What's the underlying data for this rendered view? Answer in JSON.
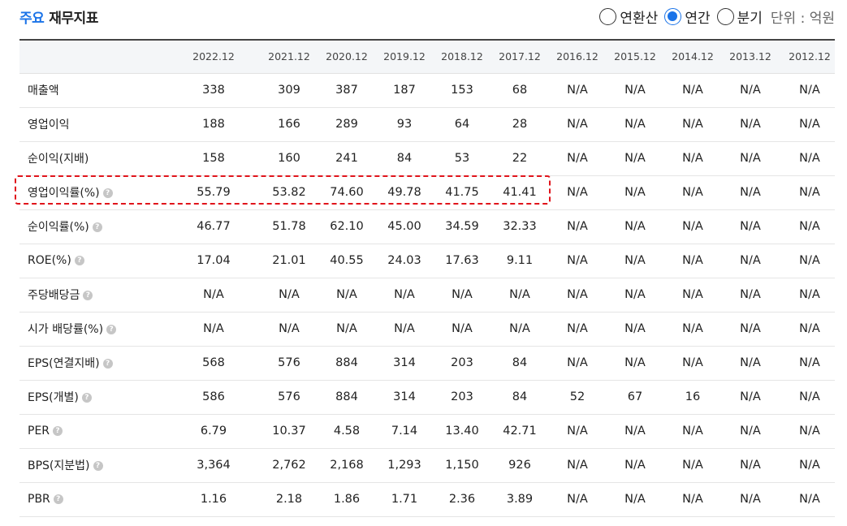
{
  "header": {
    "title_accent": "주요",
    "title_rest": "재무지표",
    "radios": [
      {
        "label": "연환산",
        "checked": false
      },
      {
        "label": "연간",
        "checked": true
      },
      {
        "label": "분기",
        "checked": false
      }
    ],
    "unit": "단위 : 억원"
  },
  "table": {
    "columns": [
      "2022.12",
      "2021.12",
      "2020.12",
      "2019.12",
      "2018.12",
      "2017.12",
      "2016.12",
      "2015.12",
      "2014.12",
      "2013.12",
      "2012.12"
    ],
    "rows": [
      {
        "label": "매출액",
        "help": false,
        "values": [
          "338",
          "309",
          "387",
          "187",
          "153",
          "68",
          "N/A",
          "N/A",
          "N/A",
          "N/A",
          "N/A"
        ]
      },
      {
        "label": "영업이익",
        "help": false,
        "values": [
          "188",
          "166",
          "289",
          "93",
          "64",
          "28",
          "N/A",
          "N/A",
          "N/A",
          "N/A",
          "N/A"
        ]
      },
      {
        "label": "순이익(지배)",
        "help": false,
        "values": [
          "158",
          "160",
          "241",
          "84",
          "53",
          "22",
          "N/A",
          "N/A",
          "N/A",
          "N/A",
          "N/A"
        ]
      },
      {
        "label": "영업이익률(%)",
        "help": true,
        "values": [
          "55.79",
          "53.82",
          "74.60",
          "49.78",
          "41.75",
          "41.41",
          "N/A",
          "N/A",
          "N/A",
          "N/A",
          "N/A"
        ]
      },
      {
        "label": "순이익률(%)",
        "help": true,
        "values": [
          "46.77",
          "51.78",
          "62.10",
          "45.00",
          "34.59",
          "32.33",
          "N/A",
          "N/A",
          "N/A",
          "N/A",
          "N/A"
        ]
      },
      {
        "label": "ROE(%)",
        "help": true,
        "values": [
          "17.04",
          "21.01",
          "40.55",
          "24.03",
          "17.63",
          "9.11",
          "N/A",
          "N/A",
          "N/A",
          "N/A",
          "N/A"
        ]
      },
      {
        "label": "주당배당금",
        "help": true,
        "values": [
          "N/A",
          "N/A",
          "N/A",
          "N/A",
          "N/A",
          "N/A",
          "N/A",
          "N/A",
          "N/A",
          "N/A",
          "N/A"
        ]
      },
      {
        "label": "시가 배당률(%)",
        "help": true,
        "values": [
          "N/A",
          "N/A",
          "N/A",
          "N/A",
          "N/A",
          "N/A",
          "N/A",
          "N/A",
          "N/A",
          "N/A",
          "N/A"
        ]
      },
      {
        "label": "EPS(연결지배)",
        "help": true,
        "values": [
          "568",
          "576",
          "884",
          "314",
          "203",
          "84",
          "N/A",
          "N/A",
          "N/A",
          "N/A",
          "N/A"
        ]
      },
      {
        "label": "EPS(개별)",
        "help": true,
        "values": [
          "586",
          "576",
          "884",
          "314",
          "203",
          "84",
          "52",
          "67",
          "16",
          "N/A",
          "N/A"
        ]
      },
      {
        "label": "PER",
        "help": true,
        "values": [
          "6.79",
          "10.37",
          "4.58",
          "7.14",
          "13.40",
          "42.71",
          "N/A",
          "N/A",
          "N/A",
          "N/A",
          "N/A"
        ]
      },
      {
        "label": "BPS(지분법)",
        "help": true,
        "values": [
          "3,364",
          "2,762",
          "2,168",
          "1,293",
          "1,150",
          "926",
          "N/A",
          "N/A",
          "N/A",
          "N/A",
          "N/A"
        ]
      },
      {
        "label": "PBR",
        "help": true,
        "values": [
          "1.16",
          "2.18",
          "1.86",
          "1.71",
          "2.36",
          "3.89",
          "N/A",
          "N/A",
          "N/A",
          "N/A",
          "N/A"
        ]
      }
    ],
    "help_glyph": "?"
  },
  "colors": {
    "accent": "#1a73e8",
    "highlight": "#e0141b"
  }
}
